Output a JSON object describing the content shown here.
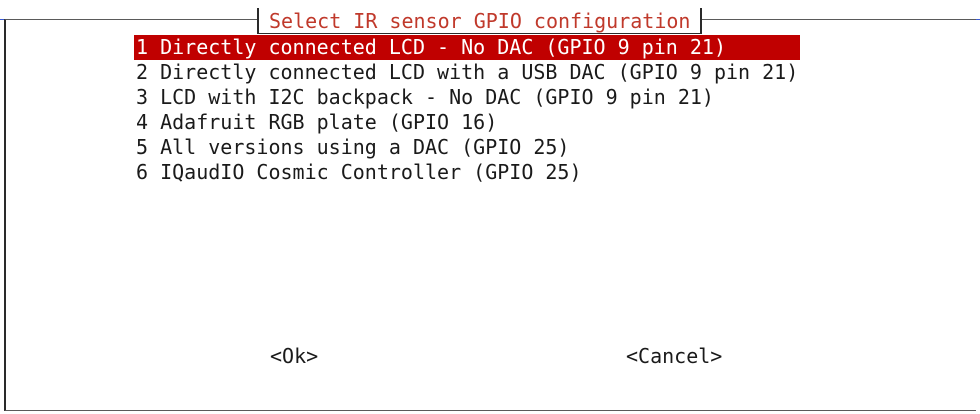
{
  "dialog": {
    "title": "Select IR sensor GPIO configuration",
    "selected_index": 0,
    "items": [
      {
        "label": "1 Directly connected LCD - No DAC (GPIO 9 pin 21)"
      },
      {
        "label": "2 Directly connected LCD with a USB DAC (GPIO 9 pin 21)"
      },
      {
        "label": "3 LCD with I2C backpack - No DAC (GPIO 9 pin 21)"
      },
      {
        "label": "4 Adafruit RGB plate (GPIO 16)"
      },
      {
        "label": "5 All versions using a DAC (GPIO 25)"
      },
      {
        "label": "6 IQaudIO Cosmic Controller (GPIO 25)"
      }
    ],
    "buttons": {
      "ok": "<Ok>",
      "cancel": "<Cancel>"
    }
  },
  "colors": {
    "selection_bg": "#c00000",
    "selection_fg": "#ffffff",
    "title_fg": "#c0392b",
    "text_fg": "#1a1a1a"
  }
}
